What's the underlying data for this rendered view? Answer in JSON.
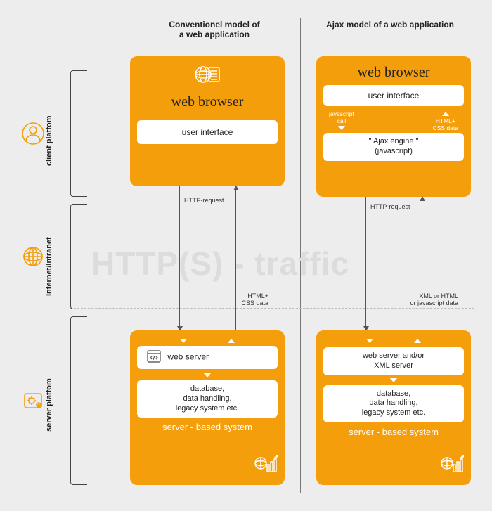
{
  "headers": {
    "conventional": "Conventionel model of\na web application",
    "ajax": "Ajax model of a web application"
  },
  "rows": {
    "client": "client platfom",
    "internet": "Internet/Intranet",
    "server": "server platfom"
  },
  "watermark": "HTTP(S) - traffic",
  "conventional": {
    "browser_title": "web browser",
    "ui_box": "user interface",
    "req_label": "HTTP-request",
    "resp_label": "HTML+\nCSS data",
    "server_title": "server - based system",
    "web_server": "web server",
    "db": "database,\ndata handling,\nlegacy system etc."
  },
  "ajax": {
    "browser_title": "web browser",
    "ui_box": "user interface",
    "js_call": "javascript\ncall",
    "htmlcss": "HTML+\nCSS data",
    "ajax_engine": "\" Ajax engine \"\n(javascript)",
    "req_label": "HTTP-request",
    "resp_label": "XML or HTML\nor javascript data",
    "server_title": "server - based system",
    "web_server": "web server and/or\nXML server",
    "db": "database,\ndata handling,\nlegacy system etc."
  },
  "icons": {
    "client": "user-icon",
    "internet": "globe-icon",
    "server": "server-icon",
    "globe_doc": "globe-doc-icon",
    "code_file": "code-file-icon",
    "server_data": "server-data-icon"
  }
}
